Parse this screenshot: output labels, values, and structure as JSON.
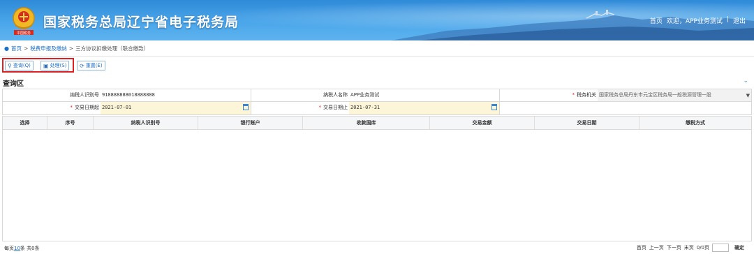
{
  "header": {
    "title": "国家税务总局辽宁省电子税务局",
    "nav": [
      "首页",
      "欢迎，APP业务测试",
      "|",
      "退出"
    ],
    "emblem_text": "中国税务"
  },
  "breadcrumb": {
    "items": [
      "首页",
      "税费申报及缴纳",
      "三方协议扣缴处理（联合缴款）"
    ],
    "separator": ">"
  },
  "toolbar": {
    "query_label": "查询(Q)",
    "process_label": "处理(S)",
    "reset_label": "重置(E)"
  },
  "section": {
    "title": "查询区"
  },
  "form": {
    "taxpayer_id_label": "纳税人识别号",
    "taxpayer_id_value": "918888888018888888",
    "taxpayer_name_label": "纳税人名称",
    "taxpayer_name_value": "APP业务测试",
    "tax_office_label": "税务机关",
    "tax_office_value": "国家税务总局丹东市元宝区税务局一般税源管理一股",
    "date_start_label": "交易日期起",
    "date_start_value": "2021-07-01",
    "date_end_label": "交易日期止",
    "date_end_value": "2021-07-31"
  },
  "table": {
    "columns": [
      "选择",
      "序号",
      "纳税人识别号",
      "银行账户",
      "收款国库",
      "交易金额",
      "交易日期",
      "缴税方式"
    ],
    "rows": []
  },
  "footer": {
    "per_page_prefix": "每页",
    "per_page_value": "10",
    "per_page_suffix": "条 共0条",
    "first": "首页",
    "prev": "上一页",
    "next": "下一页",
    "last": "末页",
    "page_info": "0/0页",
    "confirm": "确定"
  },
  "colors": {
    "header_blue": "#2f8ad8",
    "link_blue": "#1a6fc9",
    "required_red": "#e02020",
    "highlight_red": "#e02020",
    "date_field_bg": "#fdf5d7"
  }
}
